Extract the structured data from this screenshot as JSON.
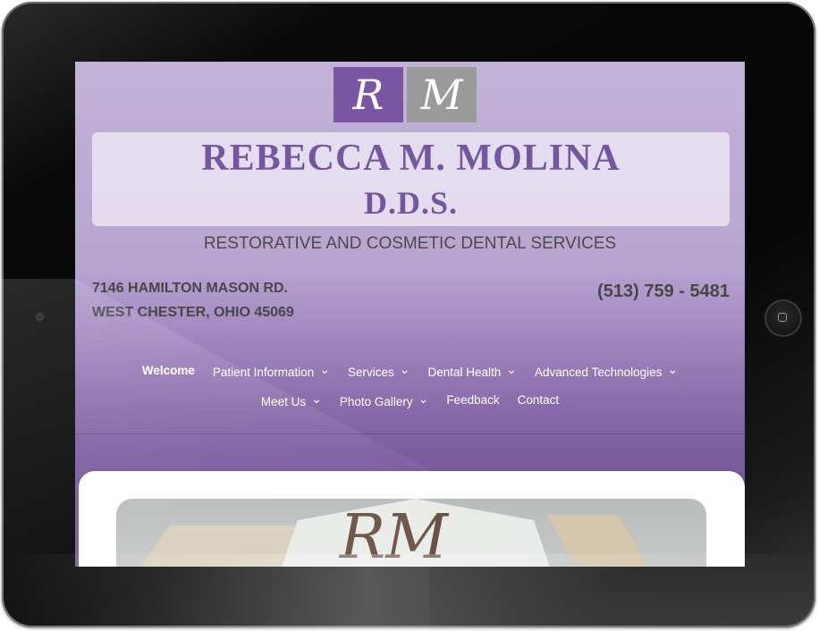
{
  "logo": {
    "left_letter": "R",
    "right_letter": "M"
  },
  "header": {
    "name": "REBECCA M. MOLINA",
    "credential": "D.D.S.",
    "tagline": "RESTORATIVE AND COSMETIC DENTAL SERVICES"
  },
  "contact": {
    "address_line1": "7146 HAMILTON MASON RD.",
    "address_line2": "WEST CHESTER, OHIO 45069",
    "phone": "(513) 759 - 5481"
  },
  "nav": {
    "row1": [
      {
        "label": "Welcome",
        "dropdown": false,
        "active": true
      },
      {
        "label": "Patient Information",
        "dropdown": true
      },
      {
        "label": "Services",
        "dropdown": true
      },
      {
        "label": "Dental Health",
        "dropdown": true
      },
      {
        "label": "Advanced Technologies",
        "dropdown": true
      }
    ],
    "row2": [
      {
        "label": "Meet Us",
        "dropdown": true
      },
      {
        "label": "Photo Gallery",
        "dropdown": true
      },
      {
        "label": "Feedback",
        "dropdown": false
      },
      {
        "label": "Contact",
        "dropdown": false
      }
    ],
    "chevron_icon": "chevron-down-icon"
  },
  "hero": {
    "letters": "RM"
  },
  "colors": {
    "brand_purple": "#7557a0",
    "logo_purple": "#7b56a3",
    "logo_gray": "#9a9a9a"
  }
}
